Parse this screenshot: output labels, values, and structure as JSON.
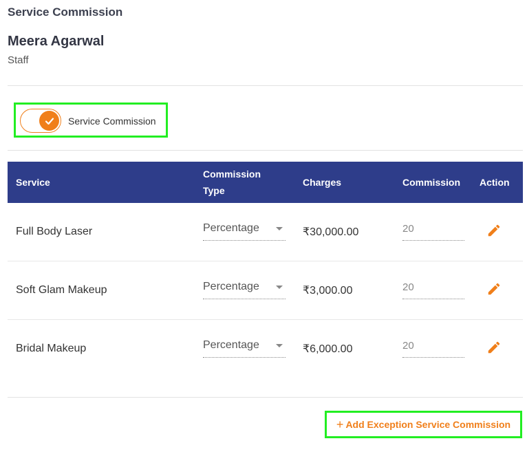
{
  "page_title": "Service Commission",
  "staff": {
    "name": "Meera Agarwal",
    "role": "Staff"
  },
  "toggle": {
    "label": "Service Commission",
    "checked": true
  },
  "table": {
    "headers": {
      "service": "Service",
      "commission_type_line1": "Commission",
      "commission_type_line2": "Type",
      "charges": "Charges",
      "commission": "Commission",
      "action": "Action"
    },
    "rows": [
      {
        "service": "Full Body Laser",
        "commission_type": "Percentage",
        "charges": "₹30,000.00",
        "commission": "20"
      },
      {
        "service": "Soft Glam Makeup",
        "commission_type": "Percentage",
        "charges": "₹3,000.00",
        "commission": "20"
      },
      {
        "service": "Bridal Makeup",
        "commission_type": "Percentage",
        "charges": "₹6,000.00",
        "commission": "20"
      }
    ]
  },
  "add_button": {
    "icon": "+",
    "label": "Add Exception Service Commission"
  },
  "colors": {
    "accent": "#f07f1a",
    "header_bg": "#2e3d8a",
    "highlight": "#22ee22"
  }
}
